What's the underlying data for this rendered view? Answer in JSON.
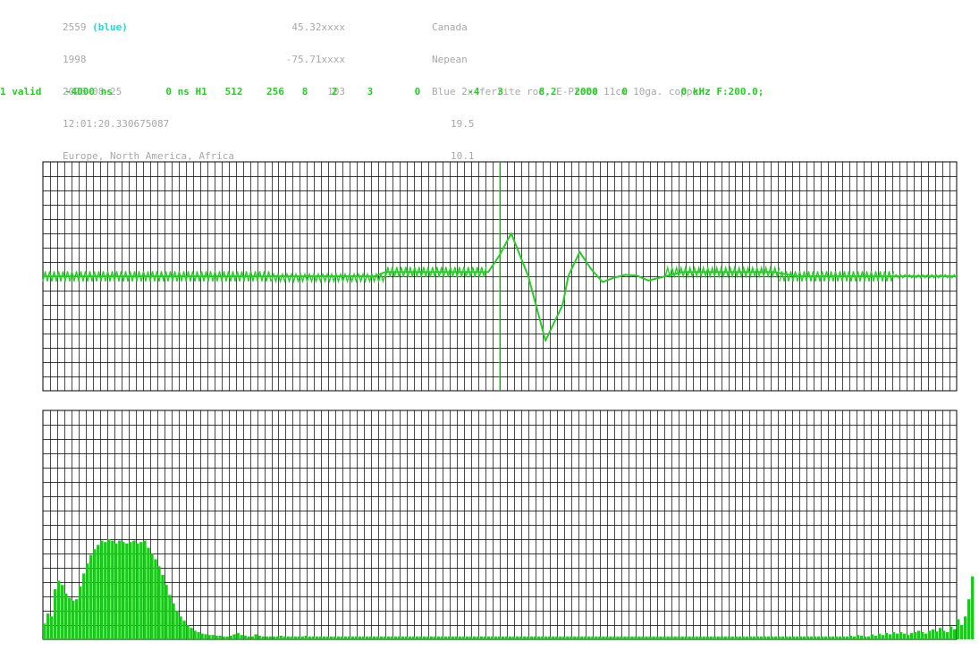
{
  "header": {
    "col1": {
      "station_id": "2559",
      "station_color": "(blue)",
      "year": "1998",
      "date": "2026-08-25",
      "time": "12:01:20.330675087",
      "regions": "Europe, North America, Africa"
    },
    "col2": {
      "lat": "45.32xxxx",
      "lon": "-75.71xxxx",
      "alt": "103"
    },
    "col3": {
      "country": "Canada",
      "city": "Nepean",
      "antenna": "Blue 2x ferrite rod, E-Probe 11cm 10ga. copper",
      "value1": "19.5",
      "value2": "10.1"
    }
  },
  "status_line": "1 valid    -4000 ns         0 ns H1   512    256   8    2     3       0        -4   3      8.2   2000    0         0 kHz F:200.0;",
  "colors": {
    "background": "#ffffff",
    "grid": "#000000",
    "trace": "#22d022",
    "bars": "#11d011",
    "info_text": "#a8a8a8",
    "accent_cyan": "#22d8d8",
    "status_text": "#22d022"
  },
  "chart_data": [
    {
      "type": "line",
      "title": "",
      "xlabel": "",
      "ylabel": "",
      "grid": true,
      "note": "time-domain waveform; x in ns (-4000 to 4000), y relative amplitude; noise band on baseline",
      "xlim": [
        -4000,
        4000
      ],
      "ylim": [
        -8,
        8
      ],
      "cursor_x": 0,
      "x": [
        -4000,
        -3000,
        -2000,
        -1100,
        -1000,
        -500,
        -100,
        0,
        100,
        250,
        400,
        550,
        600,
        700,
        800,
        900,
        1000,
        1100,
        1200,
        1300,
        1400,
        1500,
        1600,
        1800,
        2000,
        2400,
        2600,
        2900,
        3000,
        3200,
        3400,
        3600,
        3800,
        4000
      ],
      "y": [
        0,
        0,
        0,
        0,
        0.3,
        0.3,
        0.3,
        1.5,
        3,
        0,
        -4.5,
        -2,
        0,
        1.7,
        0.5,
        -0.4,
        -0.1,
        0.1,
        0.05,
        -0.3,
        -0.1,
        0.1,
        0.3,
        0.3,
        0.3,
        0.3,
        0,
        0,
        0,
        0,
        0,
        0,
        0,
        0
      ],
      "noise_band": [
        {
          "x_start": -4000,
          "x_end": -2000,
          "amplitude": 0.35,
          "offset": 0
        },
        {
          "x_start": -2000,
          "x_end": -1000,
          "amplitude": 0.25,
          "offset": -0.1
        },
        {
          "x_start": -1000,
          "x_end": -100,
          "amplitude": 0.35,
          "offset": 0.3
        },
        {
          "x_start": 1450,
          "x_end": 2450,
          "amplitude": 0.3,
          "offset": 0.3
        },
        {
          "x_start": 2450,
          "x_end": 3450,
          "amplitude": 0.35,
          "offset": 0
        },
        {
          "x_start": 3450,
          "x_end": 4000,
          "amplitude": 0.1,
          "offset": 0
        }
      ]
    },
    {
      "type": "bar",
      "title": "",
      "xlabel": "",
      "ylabel": "",
      "grid": true,
      "note": "spectrum, 255 bins, relative amplitude 0-16",
      "ylim": [
        0,
        16
      ],
      "bins": 255,
      "values": [
        1.1,
        1.8,
        1.6,
        3.5,
        4.1,
        3.8,
        3.2,
        2.9,
        2.7,
        2.8,
        3.7,
        4.6,
        5.3,
        5.9,
        6.3,
        6.6,
        6.9,
        6.8,
        7.0,
        6.9,
        6.7,
        6.9,
        6.8,
        6.7,
        6.8,
        6.9,
        6.7,
        6.8,
        6.9,
        6.4,
        6.0,
        5.6,
        5.1,
        4.5,
        3.8,
        3.1,
        2.5,
        2.0,
        1.6,
        1.3,
        1.0,
        0.8,
        0.6,
        0.5,
        0.4,
        0.35,
        0.3,
        0.3,
        0.25,
        0.25,
        0.2,
        0.2,
        0.25,
        0.35,
        0.45,
        0.3,
        0.25,
        0.2,
        0.2,
        0.35,
        0.25,
        0.2,
        0.2,
        0.2,
        0.2,
        0.2,
        0.25,
        0.2,
        0.2,
        0.2,
        0.2,
        0.2,
        0.2,
        0.25,
        0.2,
        0.2,
        0.2,
        0.2,
        0.2,
        0.2,
        0.2,
        0.2,
        0.2,
        0.2,
        0.2,
        0.2,
        0.2,
        0.2,
        0.2,
        0.2,
        0.2,
        0.2,
        0.2,
        0.2,
        0.2,
        0.2,
        0.2,
        0.2,
        0.2,
        0.2,
        0.2,
        0.2,
        0.2,
        0.2,
        0.2,
        0.2,
        0.2,
        0.2,
        0.2,
        0.2,
        0.2,
        0.2,
        0.2,
        0.2,
        0.2,
        0.2,
        0.2,
        0.2,
        0.2,
        0.2,
        0.2,
        0.2,
        0.2,
        0.2,
        0.2,
        0.2,
        0.2,
        0.2,
        0.2,
        0.2,
        0.2,
        0.2,
        0.2,
        0.2,
        0.2,
        0.2,
        0.2,
        0.2,
        0.2,
        0.2,
        0.2,
        0.2,
        0.2,
        0.2,
        0.2,
        0.2,
        0.2,
        0.2,
        0.2,
        0.2,
        0.2,
        0.2,
        0.2,
        0.2,
        0.2,
        0.2,
        0.2,
        0.2,
        0.2,
        0.2,
        0.2,
        0.2,
        0.2,
        0.2,
        0.2,
        0.2,
        0.2,
        0.2,
        0.2,
        0.2,
        0.2,
        0.2,
        0.2,
        0.2,
        0.2,
        0.2,
        0.2,
        0.2,
        0.2,
        0.2,
        0.2,
        0.2,
        0.2,
        0.2,
        0.2,
        0.2,
        0.2,
        0.2,
        0.2,
        0.2,
        0.2,
        0.2,
        0.2,
        0.2,
        0.2,
        0.2,
        0.2,
        0.2,
        0.2,
        0.2,
        0.2,
        0.2,
        0.2,
        0.2,
        0.2,
        0.2,
        0.2,
        0.2,
        0.2,
        0.2,
        0.2,
        0.2,
        0.2,
        0.2,
        0.2,
        0.2,
        0.2,
        0.2,
        0.2,
        0.2,
        0.2,
        0.2,
        0.2,
        0.2,
        0.2,
        0.25,
        0.2,
        0.3,
        0.25,
        0.2,
        0.2,
        0.35,
        0.25,
        0.4,
        0.3,
        0.45,
        0.35,
        0.5,
        0.4,
        0.5,
        0.4,
        0.3,
        0.45,
        0.5,
        0.6,
        0.5,
        0.4,
        0.6,
        0.7,
        0.55,
        0.8,
        0.6,
        0.5,
        0.9,
        0.7,
        1.4,
        1.0,
        1.6,
        2.8,
        4.4
      ]
    }
  ]
}
